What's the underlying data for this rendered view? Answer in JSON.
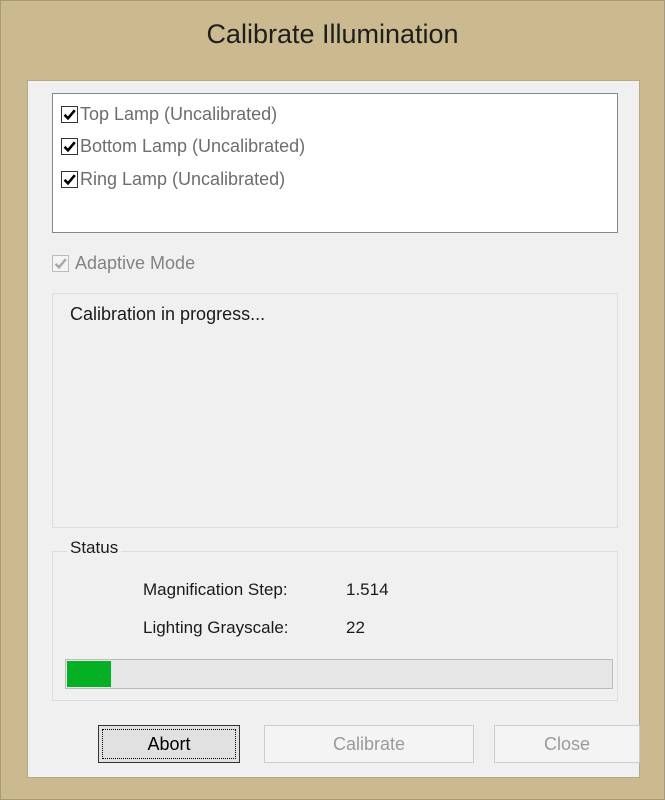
{
  "window": {
    "title": "Calibrate Illumination"
  },
  "lamps": [
    {
      "label": "Top Lamp (Uncalibrated)",
      "checked": true
    },
    {
      "label": "Bottom Lamp (Uncalibrated)",
      "checked": true
    },
    {
      "label": "Ring Lamp (Uncalibrated)",
      "checked": true
    }
  ],
  "adaptive": {
    "label": "Adaptive Mode",
    "checked": true,
    "enabled": false
  },
  "progress_message": "Calibration in progress...",
  "status": {
    "legend": "Status",
    "magnification_label": "Magnification Step:",
    "magnification_value": "1.514",
    "grayscale_label": "Lighting Grayscale:",
    "grayscale_value": "22",
    "progress_fraction": 0.08,
    "progress_color": "#06b025"
  },
  "buttons": {
    "abort": "Abort",
    "calibrate": "Calibrate",
    "close": "Close"
  },
  "colors": {
    "frame": "#cbb98f",
    "client": "#f0f0f0"
  },
  "icons": {
    "checkmark": "check-icon"
  }
}
